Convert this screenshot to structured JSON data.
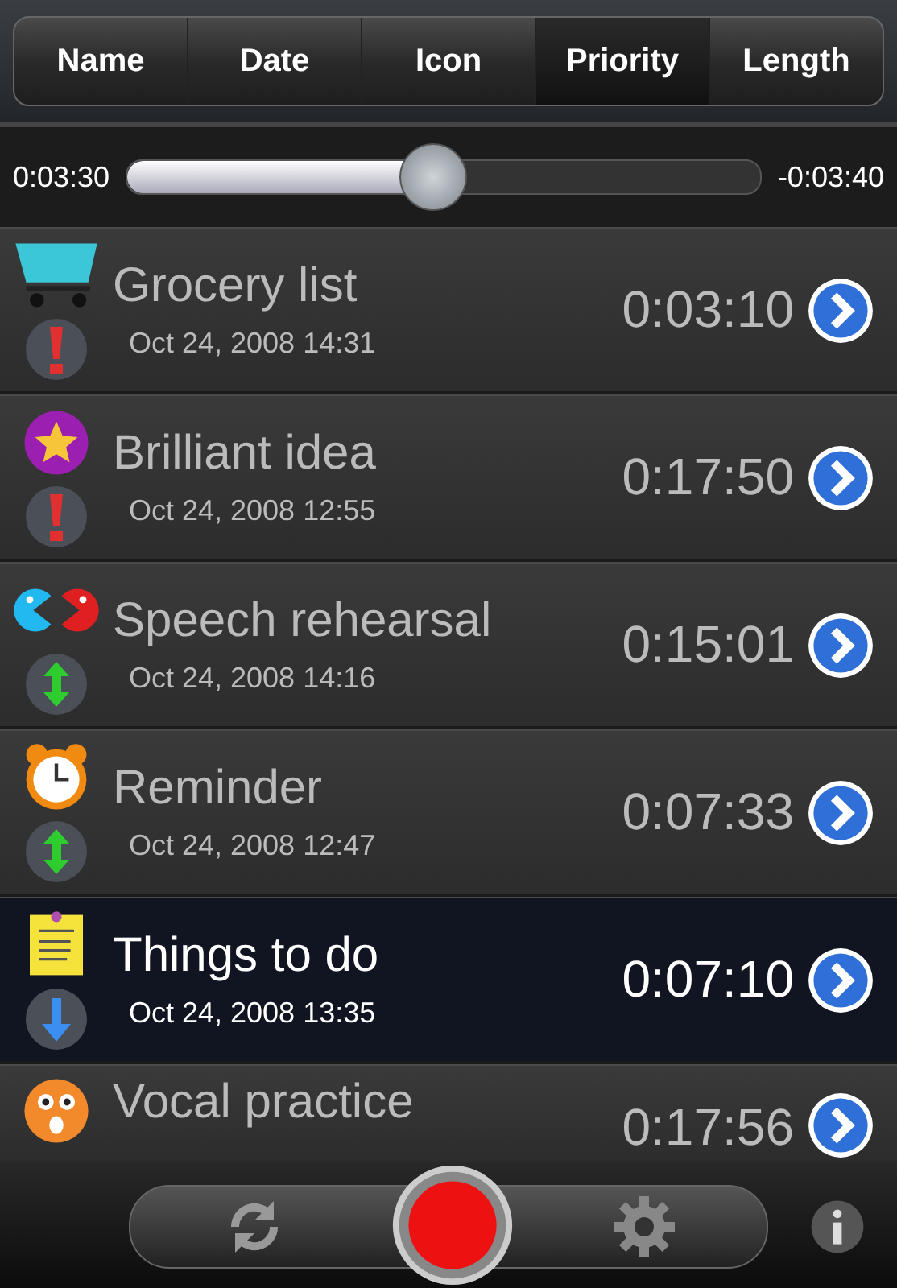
{
  "tabs": [
    {
      "label": "Name",
      "selected": false
    },
    {
      "label": "Date",
      "selected": false
    },
    {
      "label": "Icon",
      "selected": false
    },
    {
      "label": "Priority",
      "selected": true
    },
    {
      "label": "Length",
      "selected": false
    }
  ],
  "player": {
    "elapsed": "0:03:30",
    "remaining": "-0:03:40",
    "level": 0.48
  },
  "recordings": [
    {
      "icon": {
        "kind": "cart"
      },
      "title": "Grocery list",
      "date": "Oct 24, 2008 14:31",
      "priority": {
        "kind": "high"
      },
      "length": "0:03:10",
      "selected": false
    },
    {
      "icon": {
        "kind": "star"
      },
      "title": "Brilliant idea",
      "date": "Oct 24, 2008 12:55",
      "priority": {
        "kind": "high"
      },
      "length": "0:17:50",
      "selected": false
    },
    {
      "icon": {
        "kind": "pacman"
      },
      "title": "Speech rehearsal",
      "date": "Oct 24, 2008 14:16",
      "priority": {
        "kind": "medium"
      },
      "length": "0:15:01",
      "selected": false
    },
    {
      "icon": {
        "kind": "clock"
      },
      "title": "Reminder",
      "date": "Oct 24, 2008 12:47",
      "priority": {
        "kind": "medium"
      },
      "length": "0:07:33",
      "selected": false
    },
    {
      "icon": {
        "kind": "note"
      },
      "title": "Things to do",
      "date": "Oct 24, 2008 13:35",
      "priority": {
        "kind": "low"
      },
      "length": "0:07:10",
      "selected": true
    },
    {
      "icon": {
        "kind": "face"
      },
      "title": "Vocal practice",
      "length": "0:17:56",
      "selected": false
    }
  ]
}
